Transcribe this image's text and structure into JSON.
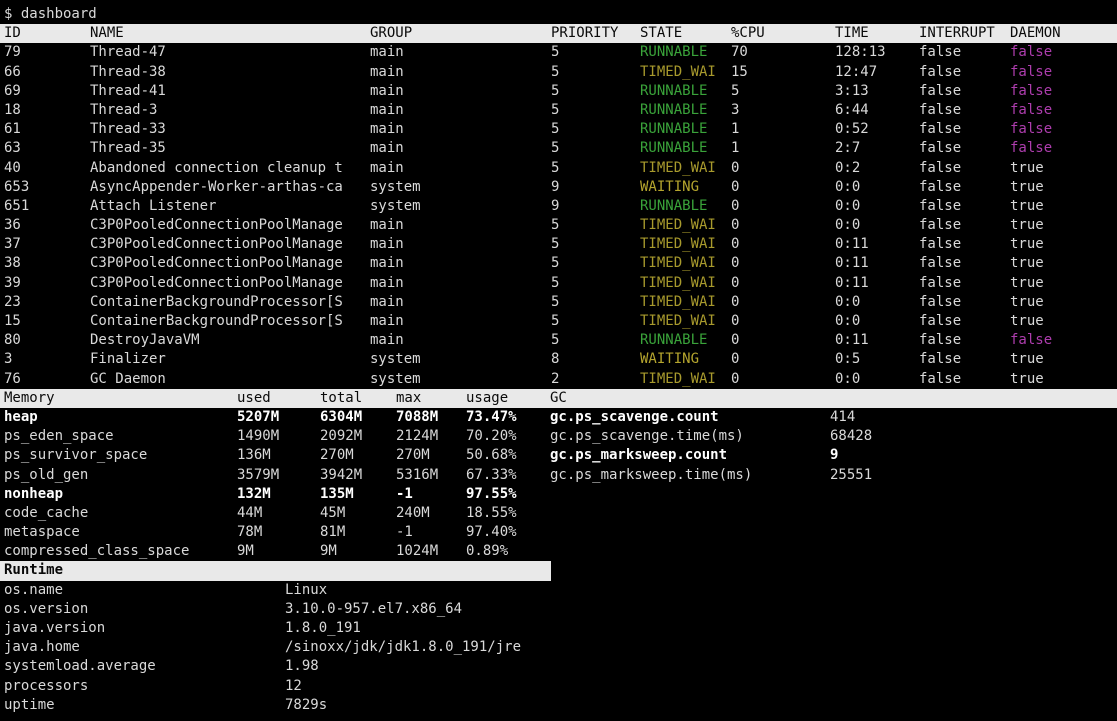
{
  "prompt": "$ dashboard",
  "colors": {
    "background": "#000000",
    "text": "#d9d9d9",
    "bold_text": "#ffffff",
    "header_bg": "#e9e9e9",
    "header_text": "#0a0a0a",
    "state_runnable": "#3aa33a",
    "state_timed_waiting": "#a89a2d",
    "state_waiting": "#b5a52e",
    "daemon_false": "#ad3dad"
  },
  "threads": {
    "headers": [
      "ID",
      "NAME",
      "GROUP",
      "PRIORITY",
      "STATE",
      "%CPU",
      "TIME",
      "INTERRUPT",
      "DAEMON"
    ],
    "rows": [
      {
        "id": "79",
        "name": "Thread-47",
        "group": "main",
        "priority": "5",
        "state": "RUNNABLE",
        "cpu": "70",
        "time": "128:13",
        "interrupt": "false",
        "daemon": "false"
      },
      {
        "id": "66",
        "name": "Thread-38",
        "group": "main",
        "priority": "5",
        "state": "TIMED_WAI",
        "cpu": "15",
        "time": "12:47",
        "interrupt": "false",
        "daemon": "false"
      },
      {
        "id": "69",
        "name": "Thread-41",
        "group": "main",
        "priority": "5",
        "state": "RUNNABLE",
        "cpu": "5",
        "time": "3:13",
        "interrupt": "false",
        "daemon": "false"
      },
      {
        "id": "18",
        "name": "Thread-3",
        "group": "main",
        "priority": "5",
        "state": "RUNNABLE",
        "cpu": "3",
        "time": "6:44",
        "interrupt": "false",
        "daemon": "false"
      },
      {
        "id": "61",
        "name": "Thread-33",
        "group": "main",
        "priority": "5",
        "state": "RUNNABLE",
        "cpu": "1",
        "time": "0:52",
        "interrupt": "false",
        "daemon": "false"
      },
      {
        "id": "63",
        "name": "Thread-35",
        "group": "main",
        "priority": "5",
        "state": "RUNNABLE",
        "cpu": "1",
        "time": "2:7",
        "interrupt": "false",
        "daemon": "false"
      },
      {
        "id": "40",
        "name": "Abandoned connection cleanup t",
        "group": "main",
        "priority": "5",
        "state": "TIMED_WAI",
        "cpu": "0",
        "time": "0:2",
        "interrupt": "false",
        "daemon": "true"
      },
      {
        "id": "653",
        "name": "AsyncAppender-Worker-arthas-ca",
        "group": "system",
        "priority": "9",
        "state": "WAITING",
        "cpu": "0",
        "time": "0:0",
        "interrupt": "false",
        "daemon": "true"
      },
      {
        "id": "651",
        "name": "Attach Listener",
        "group": "system",
        "priority": "9",
        "state": "RUNNABLE",
        "cpu": "0",
        "time": "0:0",
        "interrupt": "false",
        "daemon": "true"
      },
      {
        "id": "36",
        "name": "C3P0PooledConnectionPoolManage",
        "group": "main",
        "priority": "5",
        "state": "TIMED_WAI",
        "cpu": "0",
        "time": "0:0",
        "interrupt": "false",
        "daemon": "true"
      },
      {
        "id": "37",
        "name": "C3P0PooledConnectionPoolManage",
        "group": "main",
        "priority": "5",
        "state": "TIMED_WAI",
        "cpu": "0",
        "time": "0:11",
        "interrupt": "false",
        "daemon": "true"
      },
      {
        "id": "38",
        "name": "C3P0PooledConnectionPoolManage",
        "group": "main",
        "priority": "5",
        "state": "TIMED_WAI",
        "cpu": "0",
        "time": "0:11",
        "interrupt": "false",
        "daemon": "true"
      },
      {
        "id": "39",
        "name": "C3P0PooledConnectionPoolManage",
        "group": "main",
        "priority": "5",
        "state": "TIMED_WAI",
        "cpu": "0",
        "time": "0:11",
        "interrupt": "false",
        "daemon": "true"
      },
      {
        "id": "23",
        "name": "ContainerBackgroundProcessor[S",
        "group": "main",
        "priority": "5",
        "state": "TIMED_WAI",
        "cpu": "0",
        "time": "0:0",
        "interrupt": "false",
        "daemon": "true"
      },
      {
        "id": "15",
        "name": "ContainerBackgroundProcessor[S",
        "group": "main",
        "priority": "5",
        "state": "TIMED_WAI",
        "cpu": "0",
        "time": "0:0",
        "interrupt": "false",
        "daemon": "true"
      },
      {
        "id": "80",
        "name": "DestroyJavaVM",
        "group": "main",
        "priority": "5",
        "state": "RUNNABLE",
        "cpu": "0",
        "time": "0:11",
        "interrupt": "false",
        "daemon": "false"
      },
      {
        "id": "3",
        "name": "Finalizer",
        "group": "system",
        "priority": "8",
        "state": "WAITING",
        "cpu": "0",
        "time": "0:5",
        "interrupt": "false",
        "daemon": "true"
      },
      {
        "id": "76",
        "name": "GC Daemon",
        "group": "system",
        "priority": "2",
        "state": "TIMED_WAI",
        "cpu": "0",
        "time": "0:0",
        "interrupt": "false",
        "daemon": "true"
      }
    ]
  },
  "memory": {
    "headers": [
      "Memory",
      "used",
      "total",
      "max",
      "usage",
      "GC"
    ],
    "rows": [
      {
        "name": "heap",
        "used": "5207M",
        "total": "6304M",
        "max": "7088M",
        "usage": "73.47%",
        "bold": true
      },
      {
        "name": "ps_eden_space",
        "used": "1490M",
        "total": "2092M",
        "max": "2124M",
        "usage": "70.20%",
        "bold": false
      },
      {
        "name": "ps_survivor_space",
        "used": "136M",
        "total": "270M",
        "max": "270M",
        "usage": "50.68%",
        "bold": false
      },
      {
        "name": "ps_old_gen",
        "used": "3579M",
        "total": "3942M",
        "max": "5316M",
        "usage": "67.33%",
        "bold": false
      },
      {
        "name": "nonheap",
        "used": "132M",
        "total": "135M",
        "max": "-1",
        "usage": "97.55%",
        "bold": true
      },
      {
        "name": "code_cache",
        "used": "44M",
        "total": "45M",
        "max": "240M",
        "usage": "18.55%",
        "bold": false
      },
      {
        "name": "metaspace",
        "used": "78M",
        "total": "81M",
        "max": "-1",
        "usage": "97.40%",
        "bold": false
      },
      {
        "name": "compressed_class_space",
        "used": "9M",
        "total": "9M",
        "max": "1024M",
        "usage": "0.89%",
        "bold": false
      }
    ],
    "gc": [
      {
        "label": "gc.ps_scavenge.count",
        "value": "414",
        "label_bold": true,
        "value_bold": false
      },
      {
        "label": "gc.ps_scavenge.time(ms)",
        "value": "68428",
        "label_bold": false,
        "value_bold": false
      },
      {
        "label": "gc.ps_marksweep.count",
        "value": "9",
        "label_bold": true,
        "value_bold": true
      },
      {
        "label": "gc.ps_marksweep.time(ms)",
        "value": "25551",
        "label_bold": false,
        "value_bold": false
      }
    ]
  },
  "runtime": {
    "title": "Runtime",
    "rows": [
      {
        "key": "os.name",
        "value": "Linux"
      },
      {
        "key": "os.version",
        "value": "3.10.0-957.el7.x86_64"
      },
      {
        "key": "java.version",
        "value": "1.8.0_191"
      },
      {
        "key": "java.home",
        "value": "/sinoxx/jdk/jdk1.8.0_191/jre"
      },
      {
        "key": "systemload.average",
        "value": "1.98"
      },
      {
        "key": "processors",
        "value": "12"
      },
      {
        "key": "uptime",
        "value": "7829s"
      }
    ]
  }
}
